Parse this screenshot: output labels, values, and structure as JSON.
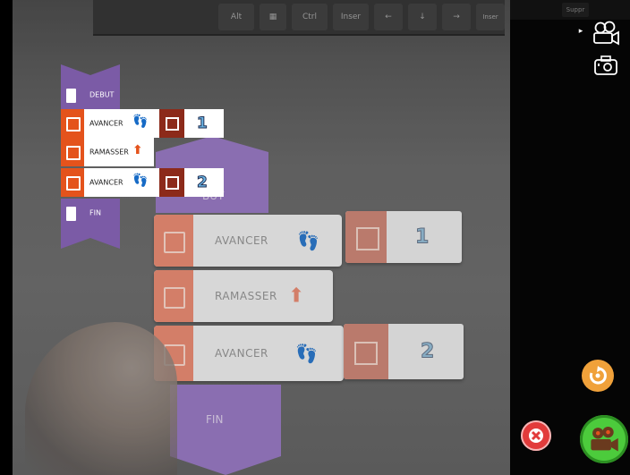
{
  "keyboard_keys": [
    "Alt",
    "",
    "Ctrl",
    "Inser",
    "←",
    "↓",
    "→",
    "Inser",
    "Suppr"
  ],
  "program": {
    "start": "DEBUT",
    "steps": [
      {
        "label": "AVANCER",
        "icon": "footsteps-icon",
        "count": "1"
      },
      {
        "label": "RAMASSER",
        "icon": "pickup-icon"
      },
      {
        "label": "AVANCER",
        "icon": "footsteps-icon",
        "count": "2"
      }
    ],
    "end": "FIN"
  },
  "physical": {
    "debut_partial": "BUT",
    "step1": "AVANCER",
    "step1_num": "1",
    "step2": "RAMASSER",
    "step3": "AVANCER",
    "step3_num": "2",
    "end": "FIN"
  },
  "controls": {
    "play_arrow": "▸",
    "colors": {
      "undo": "#f0a13a",
      "cancel": "#e23b3b",
      "record": "#4ccb3c",
      "block_orange": "#e4531c",
      "block_purple": "#7b5ba6",
      "block_darkred": "#8c2a1a"
    }
  }
}
